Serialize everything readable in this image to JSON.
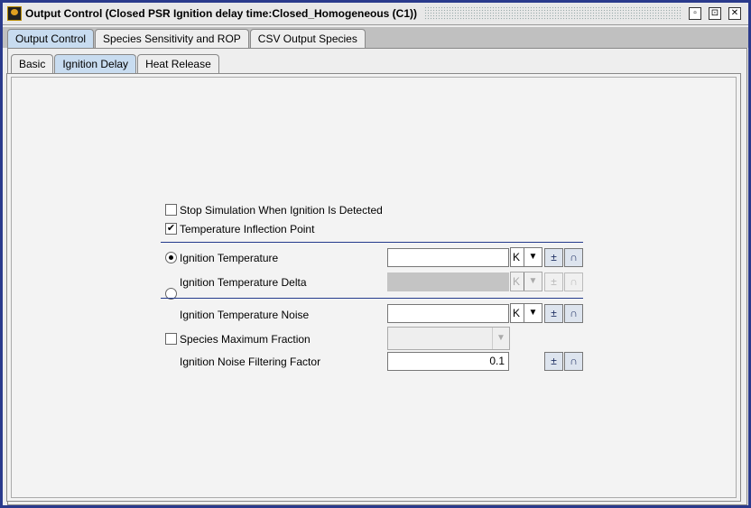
{
  "window": {
    "title": "Output Control  (Closed PSR Ignition delay time:Closed_Homogeneous (C1))"
  },
  "tabs": [
    "Output Control",
    "Species Sensitivity and ROP",
    "CSV Output Species"
  ],
  "subtabs": [
    "Basic",
    "Ignition Delay",
    "Heat Release"
  ],
  "form": {
    "stop_sim": {
      "label": "Stop Simulation When Ignition Is Detected",
      "checked": false
    },
    "temp_inflection": {
      "label": "Temperature Inflection Point",
      "checked": true,
      "mark": "✔"
    },
    "ign_temp": {
      "label": "Ignition Temperature",
      "value": "",
      "unit": "K",
      "selected": true
    },
    "ign_temp_delta": {
      "label": "Ignition Temperature Delta",
      "value": "",
      "unit": "K",
      "selected": false
    },
    "ign_temp_noise": {
      "label": "Ignition Temperature Noise",
      "value": "",
      "unit": "K"
    },
    "species_max": {
      "label": "Species Maximum Fraction",
      "checked": false,
      "value": ""
    },
    "noise_filter": {
      "label": "Ignition Noise Filtering Factor",
      "value": "0.1"
    }
  }
}
